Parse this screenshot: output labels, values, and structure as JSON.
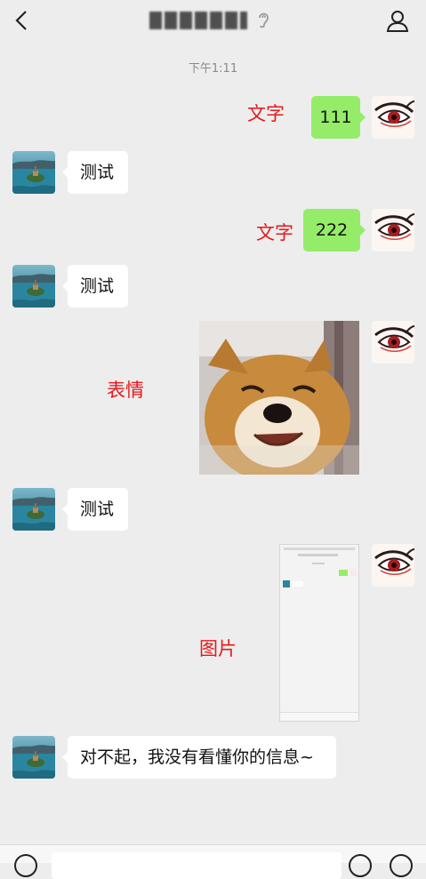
{
  "header": {
    "title": "",
    "back_icon": "chevron-left-icon",
    "ear_icon": "ear-icon",
    "profile_icon": "person-icon"
  },
  "timestamp": "下午1:11",
  "messages": [
    {
      "side": "right",
      "type": "text",
      "text": "111",
      "annotation": "文字"
    },
    {
      "side": "left",
      "type": "text",
      "text": "测试"
    },
    {
      "side": "right",
      "type": "text",
      "text": "222",
      "annotation": "文字"
    },
    {
      "side": "left",
      "type": "text",
      "text": "测试"
    },
    {
      "side": "right",
      "type": "sticker",
      "annotation": "表情"
    },
    {
      "side": "left",
      "type": "text",
      "text": "测试"
    },
    {
      "side": "right",
      "type": "image",
      "annotation": "图片"
    },
    {
      "side": "left",
      "type": "text",
      "text": "对不起，我没有看懂你的信息~"
    }
  ],
  "colors": {
    "background": "#ededed",
    "sent_bubble": "#95ec69",
    "received_bubble": "#ffffff",
    "annotation": "#e5191b"
  }
}
